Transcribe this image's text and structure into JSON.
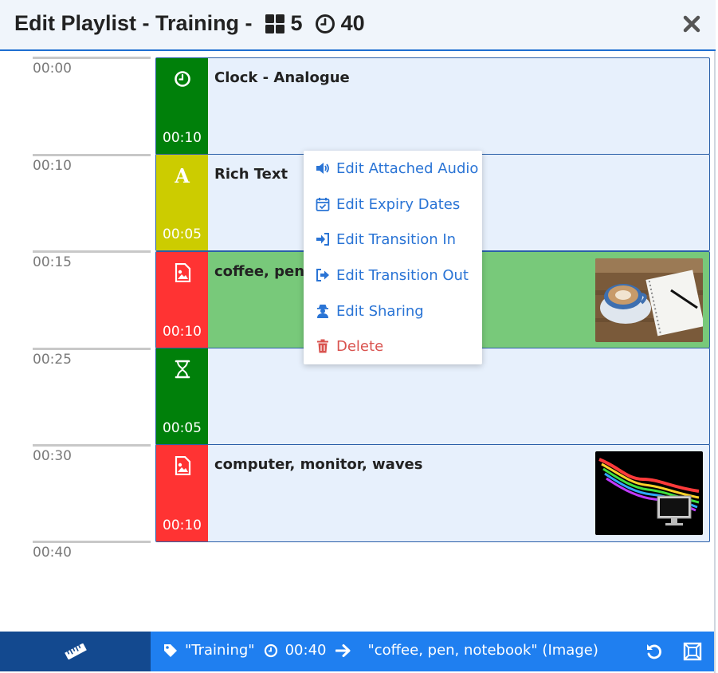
{
  "header": {
    "title": "Edit Playlist - Training -",
    "widgets_icon": "grid-icon",
    "widgets_count": "5",
    "duration_icon": "clock-icon",
    "duration": "40",
    "close_icon": "close-icon"
  },
  "timeline": {
    "ticks": [
      "00:00",
      "00:10",
      "00:15",
      "00:25",
      "00:30",
      "00:40"
    ]
  },
  "items": [
    {
      "name": "Clock - Analogue",
      "duration": "00:10",
      "icon": "clock-icon",
      "color": "#00800a"
    },
    {
      "name": "Rich Text",
      "duration": "00:05",
      "icon": "text-a-icon",
      "color": "#cccc00"
    },
    {
      "name": "coffee, pen, notebook",
      "duration": "00:10",
      "icon": "image-icon",
      "color": "#ff3333",
      "selected": true,
      "thumbnail": "coffee-cup-notebook-image"
    },
    {
      "name": "",
      "duration": "00:05",
      "icon": "hourglass-icon",
      "color": "#00800a"
    },
    {
      "name": "computer, monitor, waves",
      "duration": "00:10",
      "icon": "image-icon",
      "color": "#ff3333",
      "thumbnail": "monitor-colorful-waves-image"
    }
  ],
  "context_menu": {
    "items": [
      {
        "label": "Edit Attached Audio",
        "icon": "volume-icon"
      },
      {
        "label": "Edit Expiry Dates",
        "icon": "calendar-check-icon"
      },
      {
        "label": "Edit Transition In",
        "icon": "sign-in-icon"
      },
      {
        "label": "Edit Transition Out",
        "icon": "sign-out-icon"
      },
      {
        "label": "Edit Sharing",
        "icon": "user-secret-icon"
      },
      {
        "label": "Delete",
        "icon": "trash-icon"
      }
    ]
  },
  "footer": {
    "ruler_icon": "ruler-icon",
    "playlist_name": "\"Training\"",
    "total_duration": "00:40",
    "selected_item": "\"coffee, pen, notebook\" (Image)",
    "undo_icon": "undo-icon",
    "fullscreen_icon": "expand-icon"
  },
  "colors": {
    "accent": "#1f7ff0",
    "accent_dark": "#13498f",
    "item_bg": "#e7f0fc",
    "selected_bg": "#78c97a",
    "danger": "#d9534f",
    "link": "#2a74d5"
  }
}
